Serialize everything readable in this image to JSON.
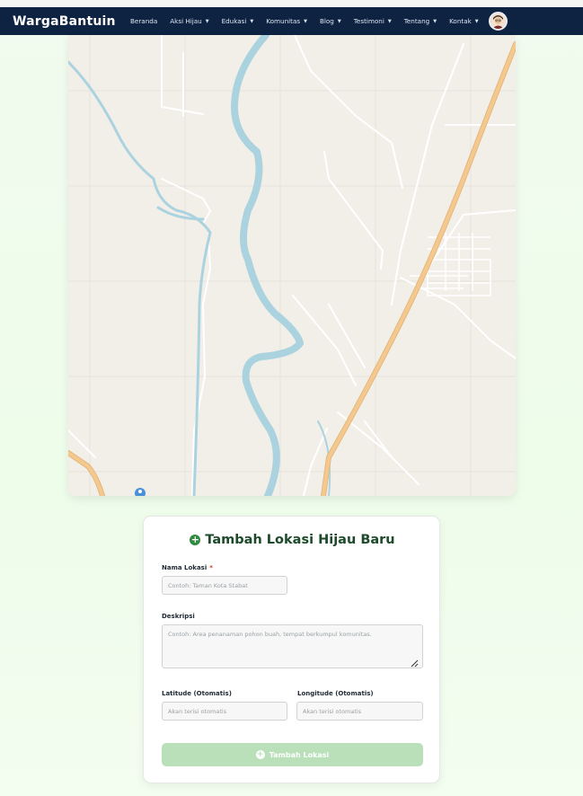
{
  "app": {
    "brand": "WargaBantuin"
  },
  "nav": {
    "items": [
      {
        "label": "Beranda",
        "has_caret": false
      },
      {
        "label": "Aksi Hijau",
        "has_caret": true
      },
      {
        "label": "Edukasi",
        "has_caret": true
      },
      {
        "label": "Komunitas",
        "has_caret": true
      },
      {
        "label": "Blog",
        "has_caret": true
      },
      {
        "label": "Testimoni",
        "has_caret": true
      },
      {
        "label": "Tentang",
        "has_caret": true
      },
      {
        "label": "Kontak",
        "has_caret": true
      }
    ],
    "caret_glyph": "▼"
  },
  "form": {
    "title": "Tambah Lokasi Hijau Baru",
    "title_icon": "plus-circle-icon",
    "name_label": "Nama Lokasi",
    "required_marker": "*",
    "name_placeholder": "Contoh: Taman Kota Stabat",
    "description_label": "Deskripsi",
    "description_placeholder": "Contoh: Area penanaman pohon buah, tempat berkumpul komunitas.",
    "latitude_label": "Latitude (Otomatis)",
    "latitude_placeholder": "Akan terisi otomatis",
    "longitude_label": "Longitude (Otomatis)",
    "longitude_placeholder": "Akan terisi otomatis",
    "submit_label": "Tambah Lokasi",
    "submit_icon": "plus-circle-icon"
  },
  "colors": {
    "navbar": "#0e2342",
    "accent_green": "#2f8a3e",
    "submit_disabled": "#b9e0b9",
    "map_land": "#f2efe9",
    "map_water": "#aad3df",
    "map_highway": "#f5c98d"
  }
}
